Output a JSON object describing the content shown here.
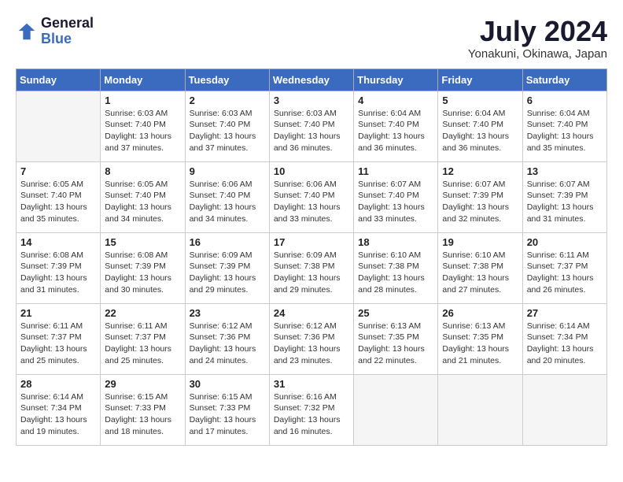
{
  "header": {
    "logo_line1": "General",
    "logo_line2": "Blue",
    "month": "July 2024",
    "location": "Yonakuni, Okinawa, Japan"
  },
  "days_of_week": [
    "Sunday",
    "Monday",
    "Tuesday",
    "Wednesday",
    "Thursday",
    "Friday",
    "Saturday"
  ],
  "weeks": [
    [
      {
        "num": "",
        "info": ""
      },
      {
        "num": "1",
        "info": "Sunrise: 6:03 AM\nSunset: 7:40 PM\nDaylight: 13 hours\nand 37 minutes."
      },
      {
        "num": "2",
        "info": "Sunrise: 6:03 AM\nSunset: 7:40 PM\nDaylight: 13 hours\nand 37 minutes."
      },
      {
        "num": "3",
        "info": "Sunrise: 6:03 AM\nSunset: 7:40 PM\nDaylight: 13 hours\nand 36 minutes."
      },
      {
        "num": "4",
        "info": "Sunrise: 6:04 AM\nSunset: 7:40 PM\nDaylight: 13 hours\nand 36 minutes."
      },
      {
        "num": "5",
        "info": "Sunrise: 6:04 AM\nSunset: 7:40 PM\nDaylight: 13 hours\nand 36 minutes."
      },
      {
        "num": "6",
        "info": "Sunrise: 6:04 AM\nSunset: 7:40 PM\nDaylight: 13 hours\nand 35 minutes."
      }
    ],
    [
      {
        "num": "7",
        "info": "Sunrise: 6:05 AM\nSunset: 7:40 PM\nDaylight: 13 hours\nand 35 minutes."
      },
      {
        "num": "8",
        "info": "Sunrise: 6:05 AM\nSunset: 7:40 PM\nDaylight: 13 hours\nand 34 minutes."
      },
      {
        "num": "9",
        "info": "Sunrise: 6:06 AM\nSunset: 7:40 PM\nDaylight: 13 hours\nand 34 minutes."
      },
      {
        "num": "10",
        "info": "Sunrise: 6:06 AM\nSunset: 7:40 PM\nDaylight: 13 hours\nand 33 minutes."
      },
      {
        "num": "11",
        "info": "Sunrise: 6:07 AM\nSunset: 7:40 PM\nDaylight: 13 hours\nand 33 minutes."
      },
      {
        "num": "12",
        "info": "Sunrise: 6:07 AM\nSunset: 7:39 PM\nDaylight: 13 hours\nand 32 minutes."
      },
      {
        "num": "13",
        "info": "Sunrise: 6:07 AM\nSunset: 7:39 PM\nDaylight: 13 hours\nand 31 minutes."
      }
    ],
    [
      {
        "num": "14",
        "info": "Sunrise: 6:08 AM\nSunset: 7:39 PM\nDaylight: 13 hours\nand 31 minutes."
      },
      {
        "num": "15",
        "info": "Sunrise: 6:08 AM\nSunset: 7:39 PM\nDaylight: 13 hours\nand 30 minutes."
      },
      {
        "num": "16",
        "info": "Sunrise: 6:09 AM\nSunset: 7:39 PM\nDaylight: 13 hours\nand 29 minutes."
      },
      {
        "num": "17",
        "info": "Sunrise: 6:09 AM\nSunset: 7:38 PM\nDaylight: 13 hours\nand 29 minutes."
      },
      {
        "num": "18",
        "info": "Sunrise: 6:10 AM\nSunset: 7:38 PM\nDaylight: 13 hours\nand 28 minutes."
      },
      {
        "num": "19",
        "info": "Sunrise: 6:10 AM\nSunset: 7:38 PM\nDaylight: 13 hours\nand 27 minutes."
      },
      {
        "num": "20",
        "info": "Sunrise: 6:11 AM\nSunset: 7:37 PM\nDaylight: 13 hours\nand 26 minutes."
      }
    ],
    [
      {
        "num": "21",
        "info": "Sunrise: 6:11 AM\nSunset: 7:37 PM\nDaylight: 13 hours\nand 25 minutes."
      },
      {
        "num": "22",
        "info": "Sunrise: 6:11 AM\nSunset: 7:37 PM\nDaylight: 13 hours\nand 25 minutes."
      },
      {
        "num": "23",
        "info": "Sunrise: 6:12 AM\nSunset: 7:36 PM\nDaylight: 13 hours\nand 24 minutes."
      },
      {
        "num": "24",
        "info": "Sunrise: 6:12 AM\nSunset: 7:36 PM\nDaylight: 13 hours\nand 23 minutes."
      },
      {
        "num": "25",
        "info": "Sunrise: 6:13 AM\nSunset: 7:35 PM\nDaylight: 13 hours\nand 22 minutes."
      },
      {
        "num": "26",
        "info": "Sunrise: 6:13 AM\nSunset: 7:35 PM\nDaylight: 13 hours\nand 21 minutes."
      },
      {
        "num": "27",
        "info": "Sunrise: 6:14 AM\nSunset: 7:34 PM\nDaylight: 13 hours\nand 20 minutes."
      }
    ],
    [
      {
        "num": "28",
        "info": "Sunrise: 6:14 AM\nSunset: 7:34 PM\nDaylight: 13 hours\nand 19 minutes."
      },
      {
        "num": "29",
        "info": "Sunrise: 6:15 AM\nSunset: 7:33 PM\nDaylight: 13 hours\nand 18 minutes."
      },
      {
        "num": "30",
        "info": "Sunrise: 6:15 AM\nSunset: 7:33 PM\nDaylight: 13 hours\nand 17 minutes."
      },
      {
        "num": "31",
        "info": "Sunrise: 6:16 AM\nSunset: 7:32 PM\nDaylight: 13 hours\nand 16 minutes."
      },
      {
        "num": "",
        "info": ""
      },
      {
        "num": "",
        "info": ""
      },
      {
        "num": "",
        "info": ""
      }
    ]
  ]
}
